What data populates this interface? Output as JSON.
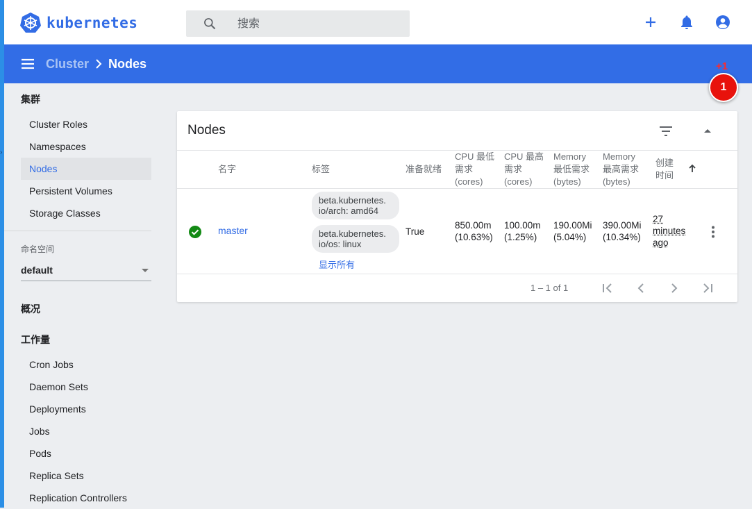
{
  "app": {
    "logo_text": "kubernetes",
    "search_placeholder": "搜索",
    "accent_color": "#326ce5",
    "toolbar_color": "#326de6"
  },
  "topbar_icons": [
    "add-icon",
    "bell-icon",
    "account-icon"
  ],
  "breadcrumb": {
    "parent": "Cluster",
    "current": "Nodes"
  },
  "overlay": {
    "counter": "+1",
    "badge": "1"
  },
  "sidebar": {
    "cluster_heading": "集群",
    "cluster_items": [
      "Cluster Roles",
      "Namespaces",
      "Nodes",
      "Persistent Volumes",
      "Storage Classes"
    ],
    "active_item": "Nodes",
    "namespace_label": "命名空间",
    "namespace_value": "default",
    "overview_heading": "概况",
    "workloads_heading": "工作量",
    "workload_items": [
      "Cron Jobs",
      "Daemon Sets",
      "Deployments",
      "Jobs",
      "Pods",
      "Replica Sets",
      "Replication Controllers"
    ]
  },
  "card": {
    "title": "Nodes",
    "columns": {
      "name": "名字",
      "labels": "标签",
      "ready": "准备就绪",
      "cpu_req": [
        "CPU 最低",
        "需求",
        "(cores)"
      ],
      "cpu_lim": [
        "CPU 最高",
        "需求",
        "(cores)"
      ],
      "mem_req": [
        "Memory",
        "最低需求",
        "(bytes)"
      ],
      "mem_lim": [
        "Memory",
        "最高需求",
        "(bytes)"
      ],
      "created": [
        "创建",
        "时间"
      ]
    },
    "rows": [
      {
        "status": "ready",
        "name": "master",
        "labels": [
          [
            "beta.kubernetes.",
            "io/arch: amd64"
          ],
          [
            "beta.kubernetes.",
            "io/os: linux"
          ]
        ],
        "show_all": "显示所有",
        "ready": "True",
        "cpu_req": [
          "850.00m",
          "(10.63%)"
        ],
        "cpu_lim": [
          "100.00m",
          "(1.25%)"
        ],
        "mem_req": [
          "190.00Mi",
          "(5.04%)"
        ],
        "mem_lim": [
          "390.00Mi",
          "(10.34%)"
        ],
        "created": [
          "27",
          "minutes",
          "ago"
        ]
      }
    ],
    "pagination": "1 – 1 of 1"
  }
}
